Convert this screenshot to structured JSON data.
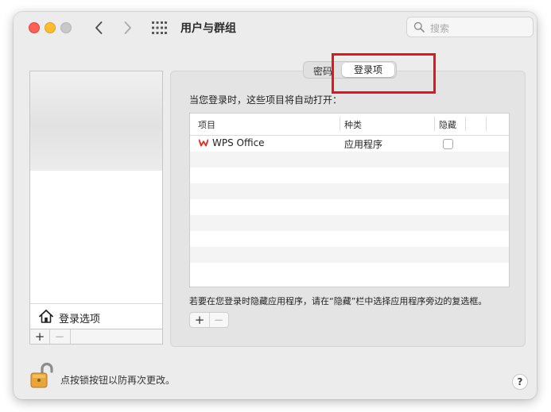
{
  "window": {
    "title": "用户与群组"
  },
  "search": {
    "placeholder": "搜索"
  },
  "tabs": {
    "password": "密码",
    "login_items": "登录项"
  },
  "content": {
    "intro": "当您登录时，这些项目将自动打开：",
    "hint": "若要在您登录时隐藏应用程序，请在“隐藏”栏中选择应用程序旁边的复选框。"
  },
  "table": {
    "headers": {
      "item": "项目",
      "kind": "种类",
      "hide": "隐藏"
    },
    "rows": [
      {
        "name": "WPS Office",
        "kind": "应用程序",
        "hidden": false
      }
    ]
  },
  "sidebar": {
    "login_options": "登录选项",
    "add": "+",
    "remove": "−"
  },
  "buttons": {
    "add": "+",
    "remove": "−"
  },
  "footer": {
    "lock_text": "点按锁按钮以防再次更改。",
    "help": "?"
  },
  "colors": {
    "highlight": "#e8141c",
    "close": "#fe5f57",
    "minimize": "#febc2e",
    "wps_red": "#e52d2d",
    "lock_gold": "#e8a53a"
  },
  "icons": [
    "back-arrow",
    "forward-arrow",
    "grid-icon",
    "search-icon",
    "house-icon",
    "wps-icon",
    "lock-icon",
    "help-icon"
  ]
}
